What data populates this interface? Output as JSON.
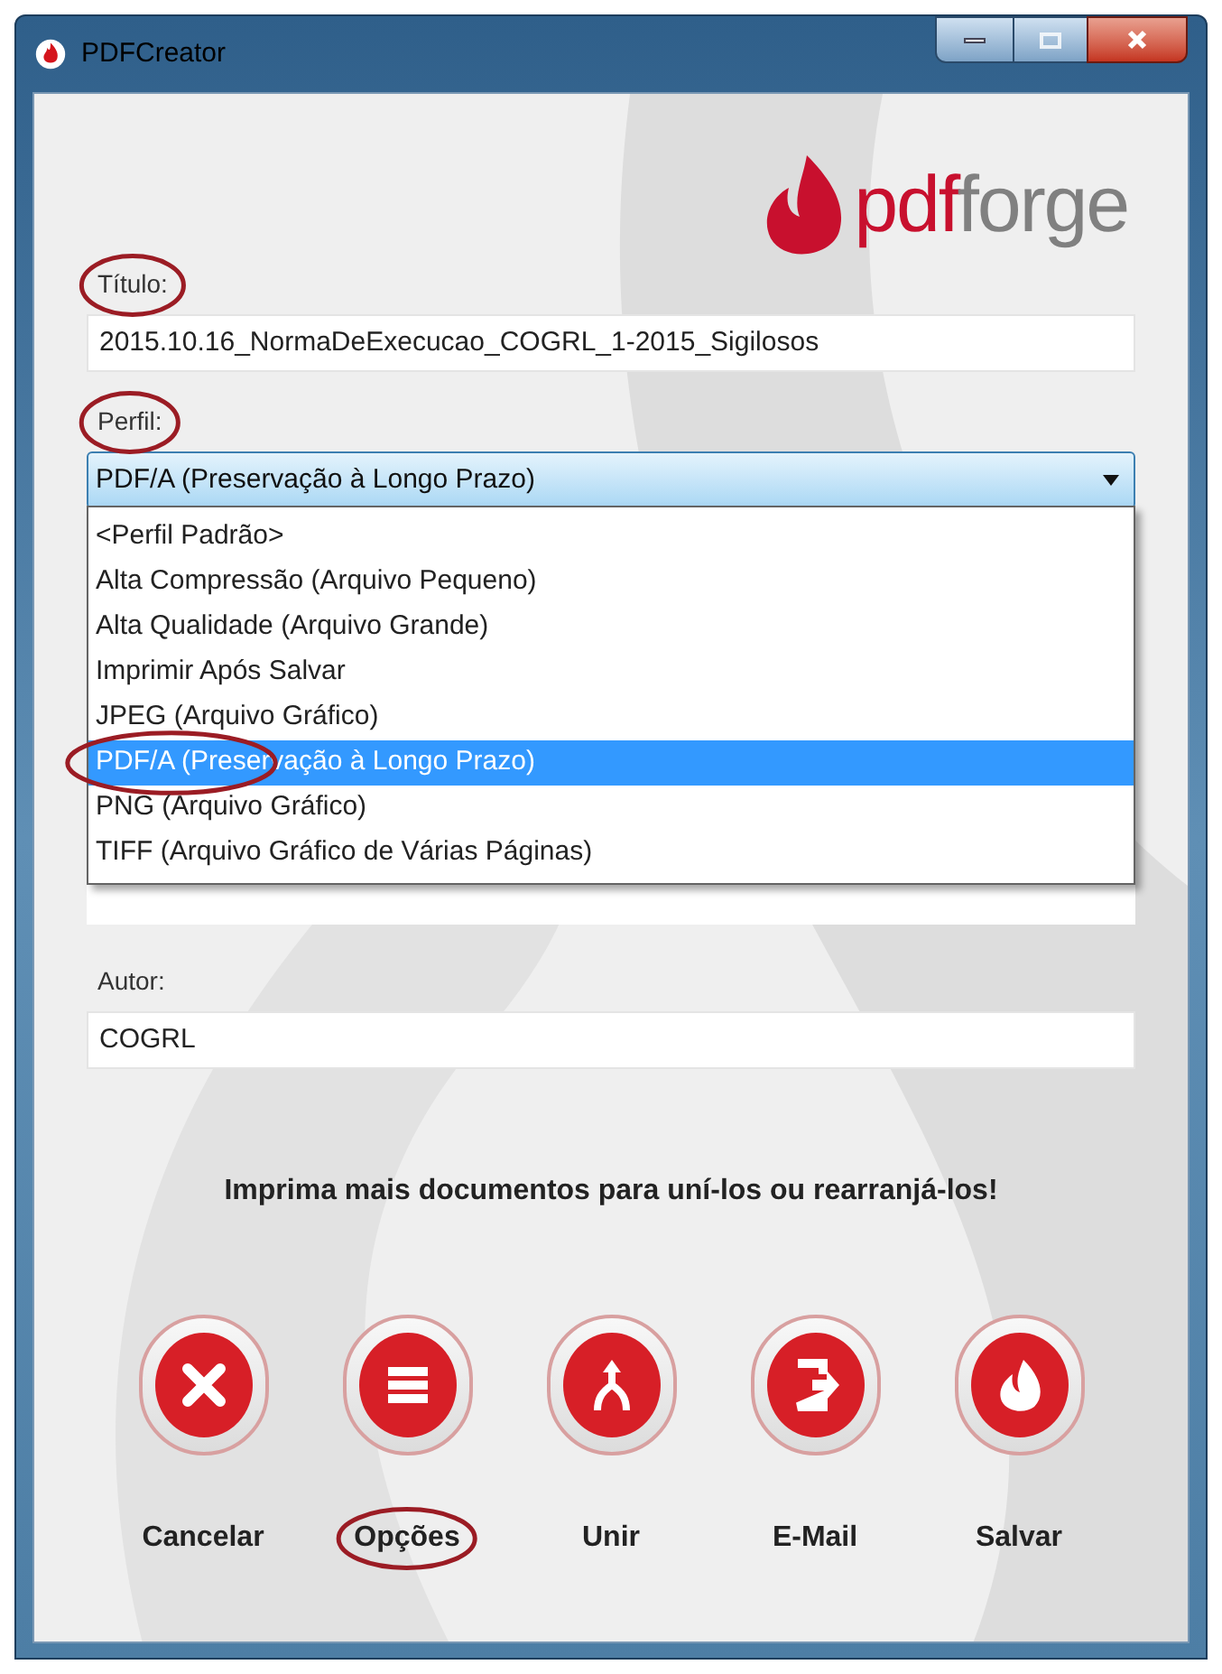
{
  "window": {
    "title": "PDFCreator"
  },
  "logo": {
    "part_1": "pdf",
    "part_2": "forge"
  },
  "title_field": {
    "label": "Título:",
    "label_circled": true,
    "value": "2015.10.16_NormaDeExecucao_COGRL_1-2015_Sigilosos"
  },
  "profile_field": {
    "label": "Perfil:",
    "label_circled": true,
    "value": "PDF/A (Preservação à Longo Prazo)",
    "expanded": true,
    "options": [
      {
        "label": "<Perfil Padrão>",
        "selected": false,
        "circled": false
      },
      {
        "label": "Alta Compressão (Arquivo Pequeno)",
        "selected": false,
        "circled": false
      },
      {
        "label": "Alta Qualidade (Arquivo Grande)",
        "selected": false,
        "circled": false
      },
      {
        "label": "Imprimir Após Salvar",
        "selected": false,
        "circled": false
      },
      {
        "label": "JPEG (Arquivo Gráfico)",
        "selected": false,
        "circled": false
      },
      {
        "label": "PDF/A (Preservação à Longo Prazo)",
        "selected": true,
        "circled": true
      },
      {
        "label": "PNG (Arquivo Gráfico)",
        "selected": false,
        "circled": false
      },
      {
        "label": "TIFF (Arquivo Gráfico de Várias Páginas)",
        "selected": false,
        "circled": false
      }
    ]
  },
  "author_field": {
    "label": "Autor:",
    "label_circled": false,
    "value": "COGRL"
  },
  "message": "Imprima mais documentos para uní-los ou rearranjá-los!",
  "actions": [
    {
      "kind": "cancel",
      "label": "Cancelar",
      "circled": false
    },
    {
      "kind": "options",
      "label": "Opções",
      "circled": true
    },
    {
      "kind": "merge",
      "label": "Unir",
      "circled": false
    },
    {
      "kind": "email",
      "label": "E-Mail",
      "circled": false
    },
    {
      "kind": "save",
      "label": "Salvar",
      "circled": false
    }
  ]
}
